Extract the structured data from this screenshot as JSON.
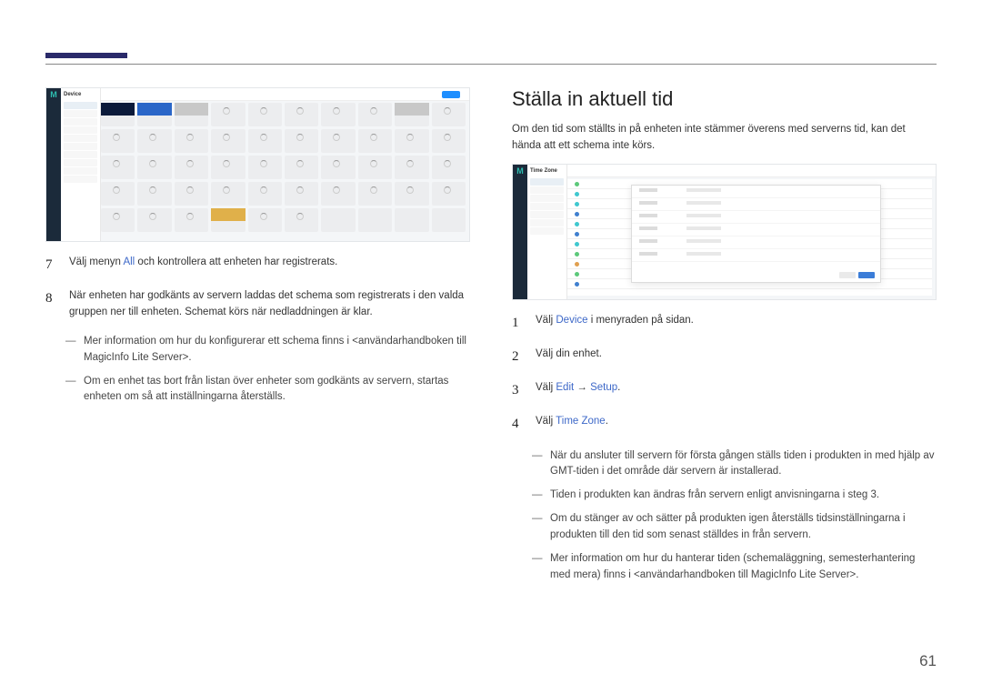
{
  "pageNumber": "61",
  "left": {
    "steps": [
      {
        "n": "7",
        "pre": "Välj menyn ",
        "link": "All",
        "post": " och kontrollera att enheten har registrerats."
      },
      {
        "n": "8",
        "text": "När enheten har godkänts av servern laddas det schema som registrerats i den valda gruppen ner till enheten. Schemat körs när nedladdningen är klar."
      }
    ],
    "notes": [
      "Mer information om hur du konfigurerar ett schema finns i <användarhandboken till MagicInfo Lite Server>.",
      "Om en enhet tas bort från listan över enheter som godkänts av servern, startas enheten om så att inställningarna återställs."
    ]
  },
  "right": {
    "heading": "Ställa in aktuell tid",
    "intro": "Om den tid som ställts in på enheten inte stämmer överens med serverns tid, kan det hända att ett schema inte körs.",
    "steps": [
      {
        "n": "1",
        "pre": "Välj ",
        "link": "Device",
        "post": " i menyraden på sidan."
      },
      {
        "n": "2",
        "text": "Välj din enhet."
      },
      {
        "n": "3",
        "pre": "Välj ",
        "link": "Edit",
        "arrow": " → ",
        "link2": "Setup",
        "post": "."
      },
      {
        "n": "4",
        "pre": "Välj ",
        "link": "Time Zone",
        "post": "."
      }
    ],
    "notes": [
      "När du ansluter till servern för första gången ställs tiden i produkten in med hjälp av GMT-tiden i det område där servern är installerad.",
      "Tiden i produkten kan ändras från servern enligt anvisningarna i steg 3.",
      "Om du stänger av och sätter på produkten igen återställs tidsinställningarna i produkten till den tid som senast ställdes in från servern.",
      "Mer information om hur du hanterar tiden (schemaläggning, semesterhantering med mera) finns i <användarhandboken till MagicInfo Lite Server>."
    ]
  },
  "ss1": {
    "panelTitle": "Device"
  },
  "ss2": {
    "panelTitle": "Time Zone"
  }
}
